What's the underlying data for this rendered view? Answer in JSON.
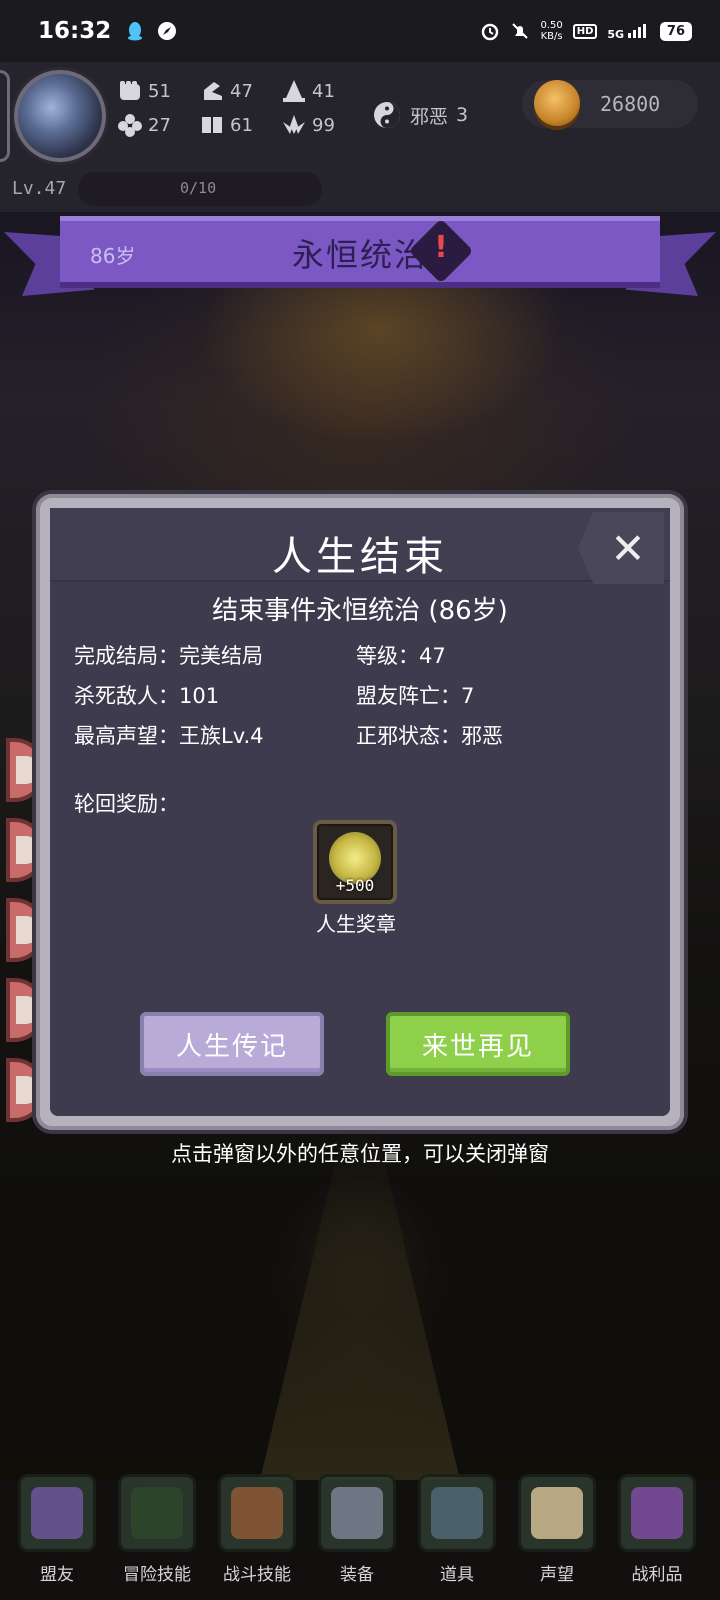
{
  "status_bar": {
    "time": "16:32",
    "net_speed_value": "0.50",
    "net_speed_unit": "KB/s",
    "hd_label": "HD",
    "signal_label": "5G",
    "battery": "76"
  },
  "hud": {
    "stats": [
      {
        "icon": "fist-icon",
        "value": "51"
      },
      {
        "icon": "boot-icon",
        "value": "47"
      },
      {
        "icon": "wizard-hat-icon",
        "value": "41"
      },
      {
        "icon": "clover-icon",
        "value": "27"
      },
      {
        "icon": "book-icon",
        "value": "61"
      },
      {
        "icon": "lotus-icon",
        "value": "99"
      }
    ],
    "alignment": {
      "label": "邪恶",
      "value": "3"
    },
    "gold": "26800",
    "level": "Lv.47",
    "xp": "0/10"
  },
  "ribbon": {
    "age": "86岁",
    "title": "永恒统治",
    "warning_symbol": "!"
  },
  "dialog": {
    "title": "人生结束",
    "close_symbol": "✕",
    "subtitle": "结束事件永恒统治 (86岁)",
    "info": [
      "完成结局：完美结局",
      "等级：47",
      "杀死敌人：101",
      "盟友阵亡：7",
      "最高声望：王族Lv.4",
      "正邪状态：邪恶"
    ],
    "reward_label": "轮回奖励：",
    "reward": {
      "amount": "+500",
      "name": "人生奖章"
    },
    "buttons": {
      "biography": "人生传记",
      "next_life": "来世再见"
    }
  },
  "hint": "点击弹窗以外的任意位置，可以关闭弹窗",
  "bottom_nav": [
    {
      "label": "盟友",
      "icon": "handshake-icon"
    },
    {
      "label": "冒险技能",
      "icon": "spellbook-icon"
    },
    {
      "label": "战斗技能",
      "icon": "backpack-icon"
    },
    {
      "label": "装备",
      "icon": "crossed-swords-icon"
    },
    {
      "label": "道具",
      "icon": "pouch-icon"
    },
    {
      "label": "声望",
      "icon": "scroll-icon"
    },
    {
      "label": "战利品",
      "icon": "treasure-chest-icon"
    }
  ]
}
